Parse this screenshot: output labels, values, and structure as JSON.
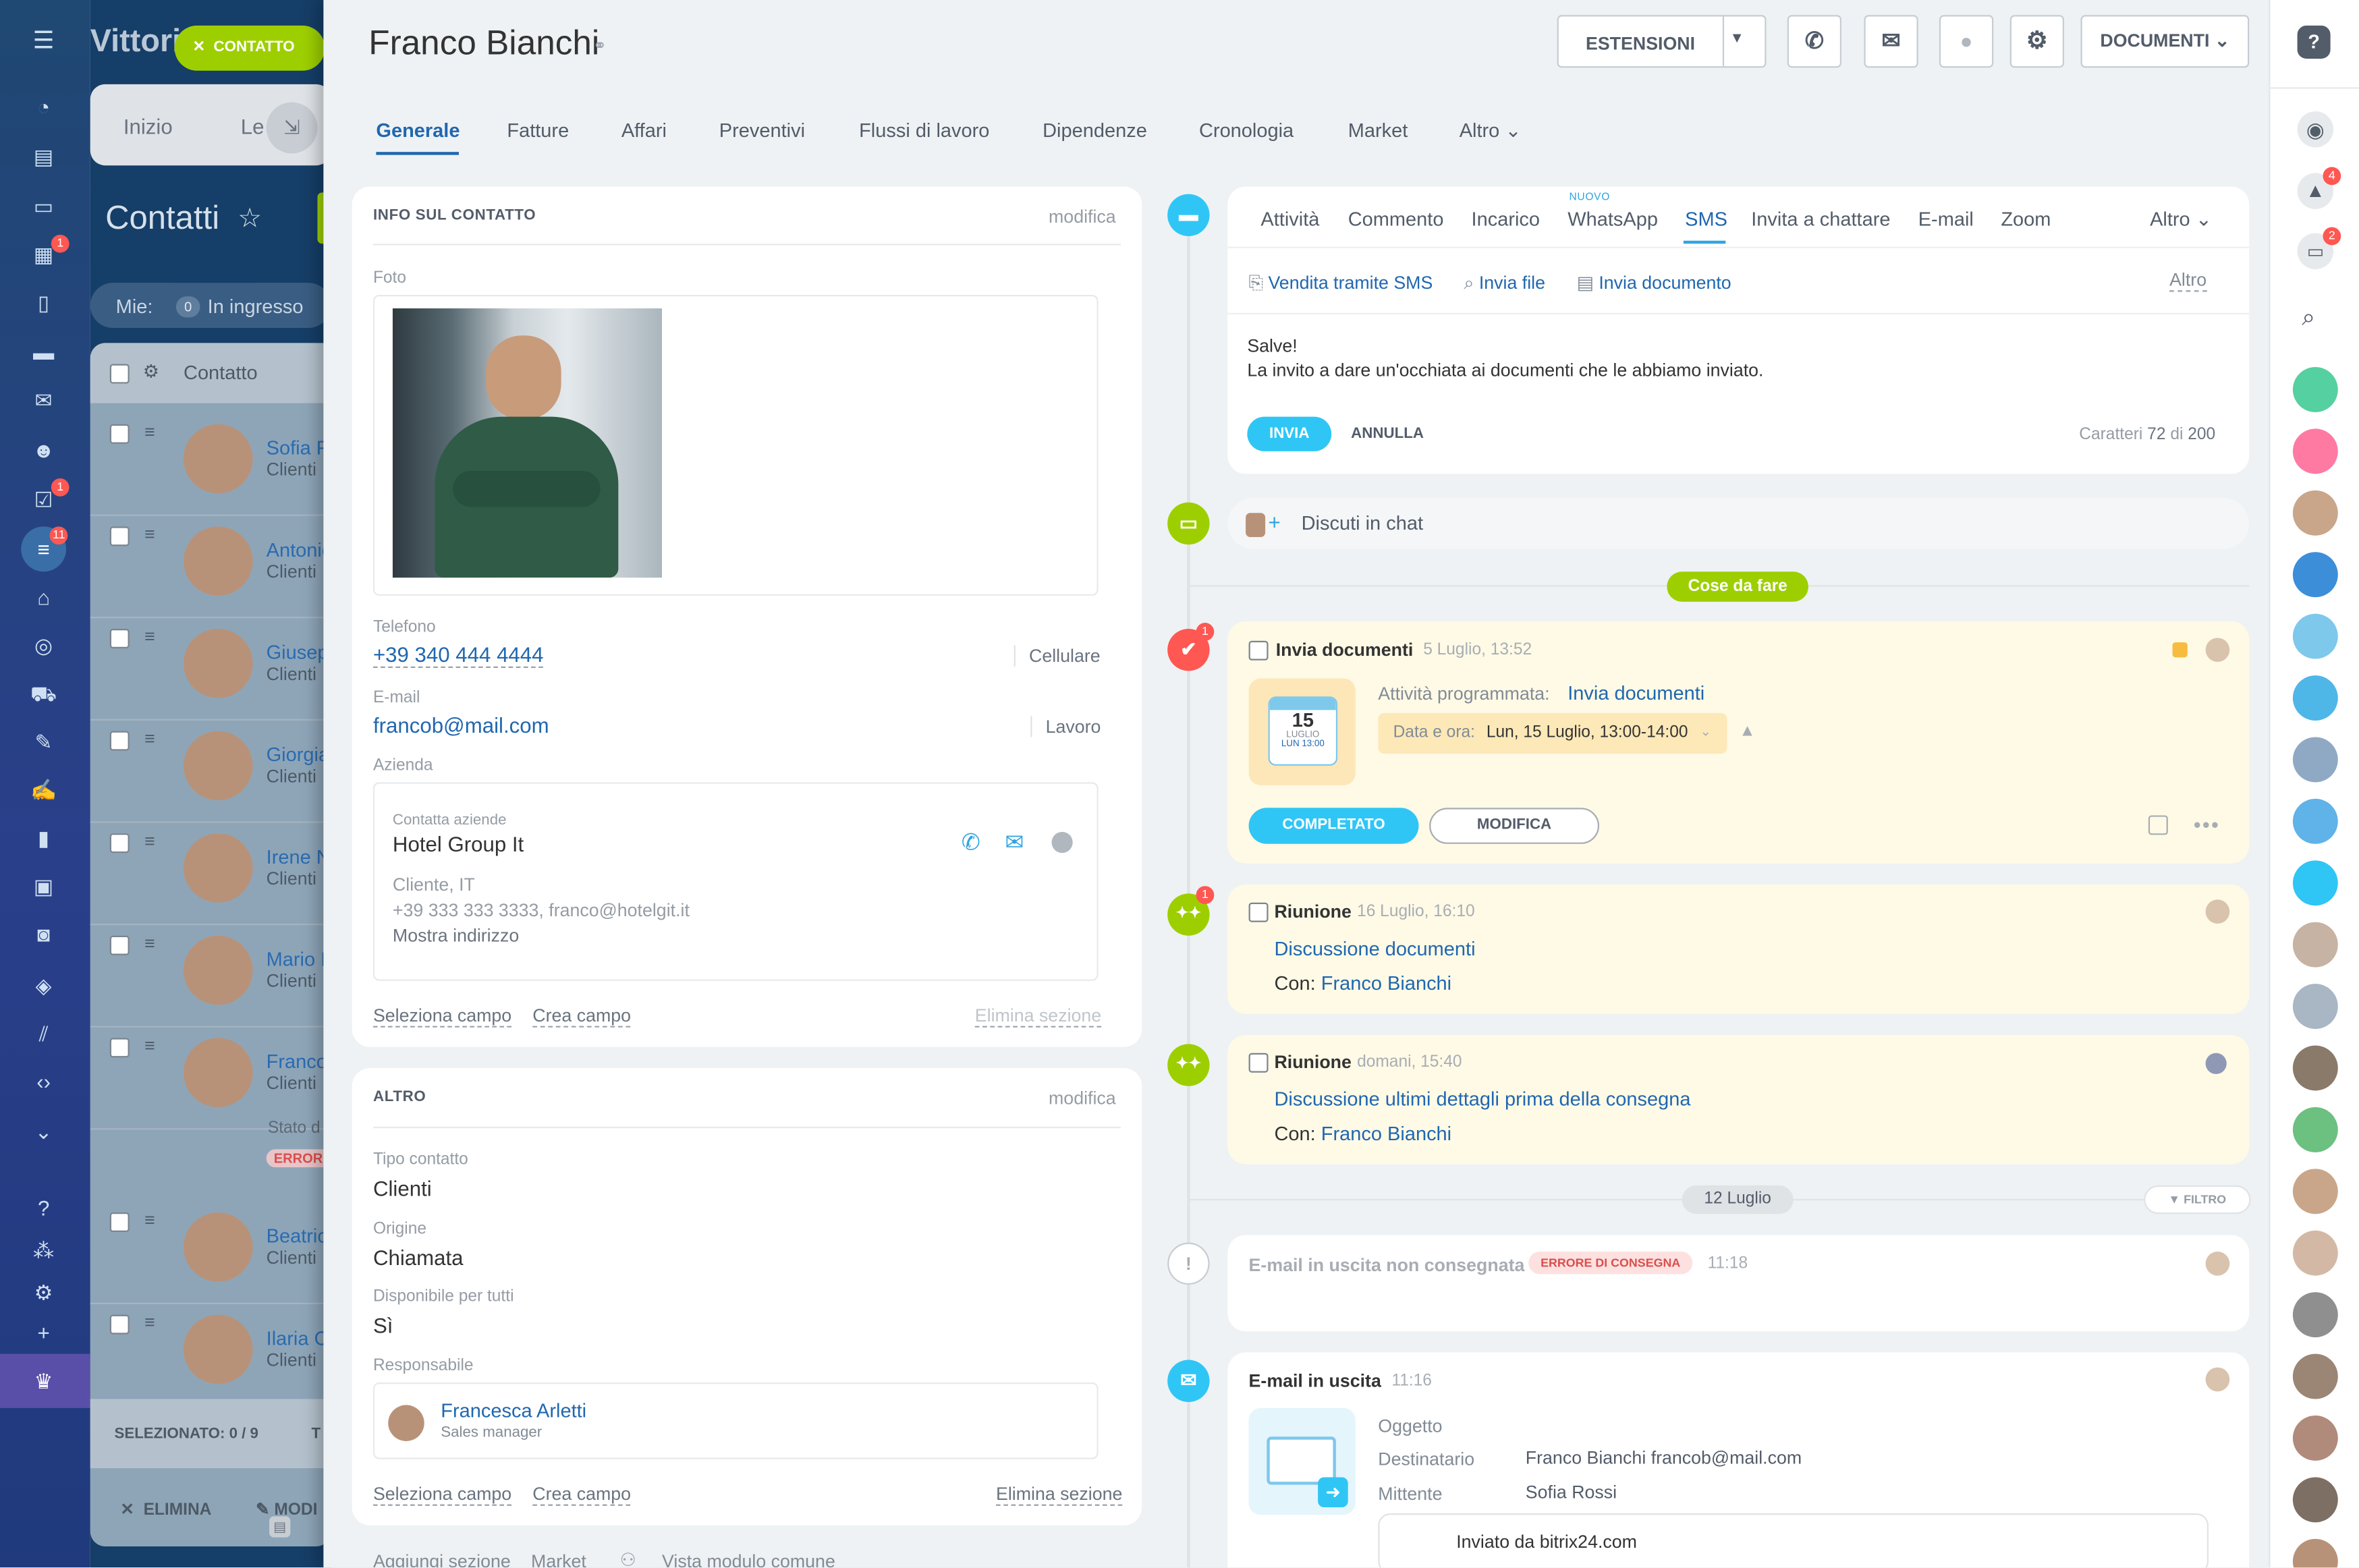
{
  "background": {
    "app_title": "Vittori",
    "contact_button": "CONTATTO",
    "tab_home": "Inizio",
    "tab_le": "Le",
    "page_title": "Contatti",
    "filter_mine": "Mie:",
    "filter_count": "0",
    "filter_incoming": "In ingresso",
    "column_contact": "Contatto",
    "rows": [
      {
        "name": "Sofia F",
        "sub": "Clienti"
      },
      {
        "name": "Antonio",
        "sub": "Clienti"
      },
      {
        "name": "Giusep",
        "sub": "Clienti"
      },
      {
        "name": "Giorgia",
        "sub": "Clienti"
      },
      {
        "name": "Irene N",
        "sub": "Clienti"
      },
      {
        "name": "Mario I",
        "sub": "Clienti"
      },
      {
        "name": "Franco",
        "sub": "Clienti"
      },
      {
        "name": "Beatric",
        "sub": "Clienti"
      },
      {
        "name": "Ilaria C",
        "sub": "Clienti"
      }
    ],
    "row_status": "Stato d",
    "row_error": "ERRORE",
    "selected": "SELEZIONATO: 0 / 9",
    "selected_extra": "T",
    "delete_action": "ELIMINA",
    "modify_action": "MODI"
  },
  "left_nav_badges": {
    "calendar": "1",
    "tasks": "1",
    "pipeline": "11"
  },
  "header": {
    "title": "Franco Bianchi",
    "extensions_button": "ESTENSIONI",
    "documents_button": "DOCUMENTI"
  },
  "tabs": [
    "Generale",
    "Fatture",
    "Affari",
    "Preventivi",
    "Flussi di lavoro",
    "Dipendenze",
    "Cronologia",
    "Market",
    "Altro"
  ],
  "info": {
    "section_title": "INFO SUL CONTATTO",
    "edit": "modifica",
    "photo_label": "Foto",
    "phone_label": "Telefono",
    "phone_value": "+39 340 444 4444",
    "phone_type": "Cellulare",
    "email_label": "E-mail",
    "email_value": "francob@mail.com",
    "email_type": "Lavoro",
    "company_label": "Azienda",
    "company_caption": "Contatta aziende",
    "company_name": "Hotel Group It",
    "company_location": "Cliente, IT",
    "company_contacts": "+39 333 333 3333, franco@hotelgit.it",
    "company_address": "Mostra indirizzo",
    "select_field": "Seleziona campo",
    "create_field": "Crea campo",
    "delete_section": "Elimina sezione"
  },
  "other": {
    "section_title": "ALTRO",
    "edit": "modifica",
    "type_label": "Tipo contatto",
    "type_value": "Clienti",
    "origin_label": "Origine",
    "origin_value": "Chiamata",
    "available_label": "Disponibile per tutti",
    "available_value": "Sì",
    "owner_label": "Responsabile",
    "owner_name": "Francesca Arletti",
    "owner_role": "Sales manager",
    "select_field": "Seleziona campo",
    "create_field": "Crea campo",
    "delete_section": "Elimina sezione"
  },
  "footer": {
    "add_section": "Aggiungi sezione",
    "market": "Market",
    "common_view": "Vista modulo comune"
  },
  "composer": {
    "tabs": [
      "Attività",
      "Commento",
      "Incarico",
      "WhatsApp",
      "SMS",
      "Invita a chattare",
      "E-mail",
      "Zoom"
    ],
    "new_badge": "NUOVO",
    "more": "Altro",
    "sub_sms_sale": "Vendita tramite SMS",
    "sub_send_file": "Invia file",
    "sub_send_doc": "Invia documento",
    "sub_more": "Altro",
    "message_line1": "Salve!",
    "message_line2": "La invito a dare un'occhiata ai documenti che le abbiamo inviato.",
    "send": "INVIA",
    "cancel": "ANNULLA",
    "chars_label": "Caratteri",
    "chars_count": "72",
    "chars_of": "di",
    "chars_max": "200"
  },
  "chat": {
    "label": "Discuti in chat"
  },
  "todo_label": "Cose da fare",
  "activity1": {
    "title": "Invia documenti",
    "date": "5 Luglio, 13:52",
    "badge": "1",
    "cal_day": "15",
    "cal_month": "LUGLIO",
    "cal_time": "LUN 13:00",
    "scheduled_label": "Attività programmata:",
    "scheduled_link": "Invia documenti",
    "datetime_label": "Data e ora:",
    "datetime_value": "Lun, 15 Luglio, 13:00-14:00",
    "complete": "COMPLETATO",
    "modify": "MODIFICA"
  },
  "meeting1": {
    "title": "Riunione",
    "date": "16 Luglio, 16:10",
    "badge": "1",
    "link": "Discussione documenti",
    "with_label": "Con:",
    "with_name": "Franco Bianchi"
  },
  "meeting2": {
    "title": "Riunione",
    "date": "domani, 15:40",
    "link": "Discussione ultimi dettagli prima della consegna",
    "with_label": "Con:",
    "with_name": "Franco Bianchi"
  },
  "date_divider": "12 Luglio",
  "filter_button": "FILTRO",
  "email_failed": {
    "title": "E-mail in uscita non consegnata",
    "status": "ERRORE DI CONSEGNA",
    "time": "11:18"
  },
  "email_out": {
    "title": "E-mail in uscita",
    "time": "11:16",
    "subject_label": "Oggetto",
    "recipient_label": "Destinatario",
    "recipient_value": "Franco Bianchi francob@mail.com",
    "sender_label": "Mittente",
    "sender_value": "Sofia Rossi",
    "body": "Inviato da bitrix24.com"
  },
  "right_bar_badges": {
    "notifications": "4",
    "chats": "2"
  },
  "colors": {
    "accent": "#2fc6f6",
    "green": "#9dcf00",
    "red": "#ff5752",
    "link": "#2067b0",
    "yellow_bg": "#fffae6"
  }
}
